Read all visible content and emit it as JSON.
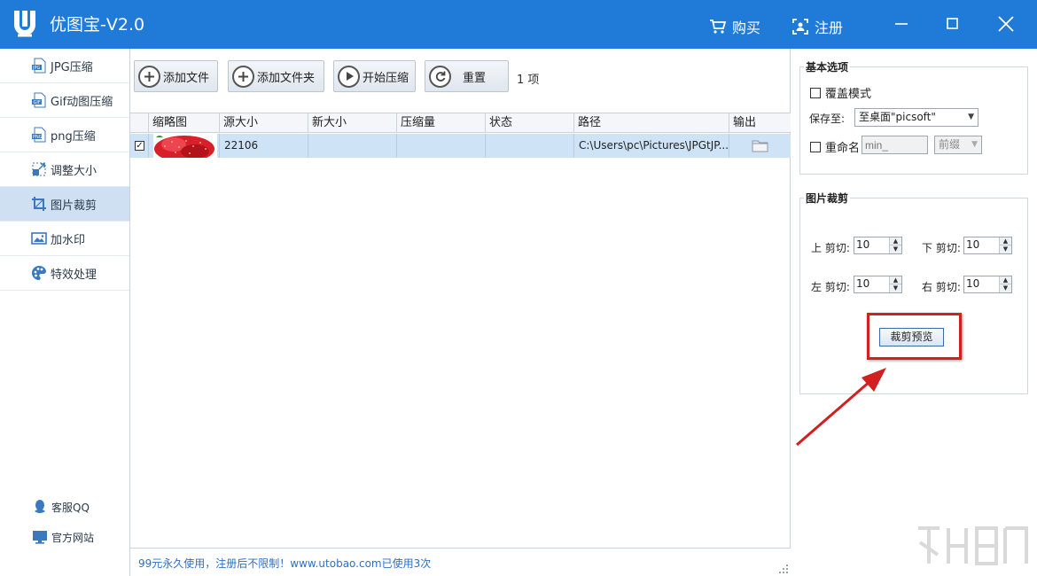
{
  "app": {
    "title": "优图宝-V2.0",
    "buy_label": "购买",
    "register_label": "注册"
  },
  "sidebar": {
    "items": [
      {
        "label": "JPG压缩",
        "icon": "jpg-file-icon"
      },
      {
        "label": "Gif动图压缩",
        "icon": "gif-file-icon"
      },
      {
        "label": "png压缩",
        "icon": "png-file-icon"
      },
      {
        "label": "调整大小",
        "icon": "resize-icon"
      },
      {
        "label": "图片裁剪",
        "icon": "crop-icon",
        "active": true
      },
      {
        "label": "加水印",
        "icon": "image-icon"
      },
      {
        "label": "特效处理",
        "icon": "palette-icon"
      }
    ],
    "footer": [
      {
        "label": "客服QQ",
        "icon": "qq-icon"
      },
      {
        "label": "官方网站",
        "icon": "monitor-icon"
      }
    ]
  },
  "toolbar": {
    "add_file": "添加文件",
    "add_folder": "添加文件夹",
    "start_compress": "开始压缩",
    "reset": "重置",
    "count": "1 项"
  },
  "table": {
    "columns": [
      "缩略图",
      "源大小",
      "新大小",
      "压缩量",
      "状态",
      "路径",
      "输出"
    ],
    "rows": [
      {
        "checked": true,
        "source_size": "22106",
        "new_size": "",
        "compression": "",
        "status": "",
        "path": "C:\\Users\\pc\\Pictures\\JPGtJP...",
        "output_icon": "folder-icon"
      }
    ]
  },
  "status_bar": {
    "text": "99元永久使用，注册后不限制！www.utobao.com已使用3次"
  },
  "basic_options": {
    "title": "基本选项",
    "overwrite_label": "覆盖模式",
    "save_to_label": "保存至:",
    "save_to_value": "至桌面\"picsoft\"",
    "rename_label": "重命名",
    "rename_placeholder": "min_",
    "prefix_value": "前缀"
  },
  "crop": {
    "title": "图片裁剪",
    "top_label": "上  剪切:",
    "bottom_label": "下  剪切:",
    "left_label": "左  剪切:",
    "right_label": "右  剪切:",
    "top_value": "10",
    "bottom_value": "10",
    "left_value": "10",
    "right_value": "10",
    "preview_button": "裁剪预览"
  },
  "colors": {
    "titlebar": "#1f7ad8",
    "sidebar_active": "#cfe0f3",
    "row_selected": "#cfe3f6",
    "annotation_red": "#d21f1f",
    "status_link": "#2c6fc7"
  }
}
